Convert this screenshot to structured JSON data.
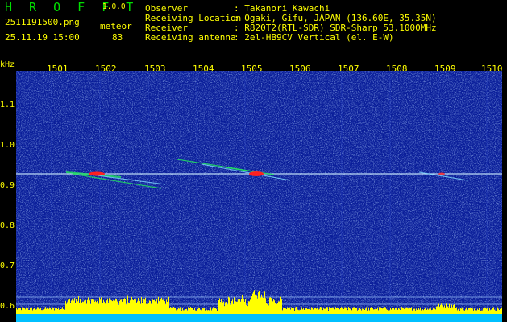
{
  "header": {
    "app_name": "H R O F F T",
    "version": "1.0.0",
    "filename": "2511191500.png",
    "detection_type": "meteor",
    "timestamp": "25.11.19 15:00",
    "count": "83",
    "fields": [
      {
        "label": "Observer",
        "value": ": Takanori Kawachi"
      },
      {
        "label": "Receiving Location",
        "value": ": Ogaki, Gifu, JAPAN (136.60E, 35.35N)"
      },
      {
        "label": "Receiver",
        "value": ": R820T2(RTL-SDR) SDR-Sharp 53.1000MHz"
      },
      {
        "label": "Receiving antenna",
        "value": ": 2el-HB9CV Vertical (el. E-W)"
      }
    ]
  },
  "x_axis": {
    "ticks": [
      "1501",
      "1502",
      "1503",
      "1504",
      "1505",
      "1506",
      "1507",
      "1508",
      "1509",
      "1510"
    ]
  },
  "y_axis": {
    "unit": "kHz",
    "ticks": [
      "1.1",
      "1.0",
      "0.9",
      "0.8",
      "0.7",
      "0.6"
    ]
  },
  "colors": {
    "background": "#0a1e9a",
    "signal_line": "#d0f0ff",
    "meteor_hot": "#ff2020",
    "meteor_warm": "#20e060",
    "amplitude": "#ffff00",
    "floor": "#00c0ff",
    "text_green": "#00e000",
    "text_yellow": "#ffff00"
  }
}
